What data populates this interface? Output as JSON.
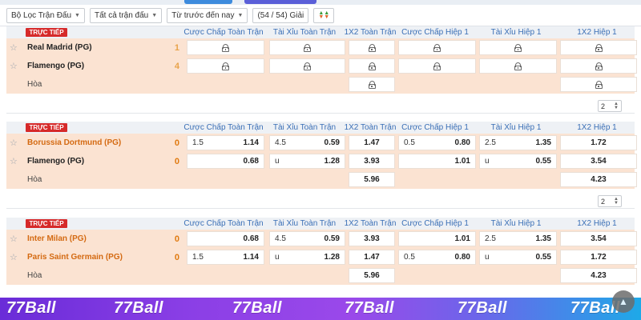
{
  "toolbar": {
    "filter_league": "Bộ Lọc Trận Đấu",
    "filter_matches": "Tất cả trận đấu",
    "sort_time": "Từ trước đến nay",
    "league_count": "(54 / 54) Giải"
  },
  "columns": [
    "Cược Chấp Toàn Trận",
    "Tài Xỉu Toàn Trận",
    "1X2 Toàn Trận",
    "Cược Chấp Hiệp 1",
    "Tài Xỉu Hiệp 1",
    "1X2 Hiệp 1"
  ],
  "live_label": "TRỰC TIẾP",
  "draw_label": "Hòa",
  "matches": [
    {
      "home": "Real Madrid (PG)",
      "home_score": "1",
      "away": "Flamengo (PG)",
      "away_score": "4",
      "locked": true,
      "pager": "2"
    },
    {
      "home": "Borussia Dortmund (PG)",
      "home_score": "0",
      "away": "Flamengo (PG)",
      "away_score": "0",
      "odds": {
        "home": {
          "hdp_line": "1.5",
          "hdp": "1.14",
          "ou_line": "4.5",
          "ou": "0.59",
          "x12": "1.47",
          "h1_hdp_line": "0.5",
          "h1_hdp": "0.80",
          "h1_ou_line": "2.5",
          "h1_ou": "1.35",
          "h1_x12": "1.72"
        },
        "away": {
          "hdp_line": "",
          "hdp": "0.68",
          "ou_line": "u",
          "ou": "1.28",
          "x12": "3.93",
          "h1_hdp_line": "",
          "h1_hdp": "1.01",
          "h1_ou_line": "u",
          "h1_ou": "0.55",
          "h1_x12": "3.54"
        },
        "draw": {
          "x12": "5.96",
          "h1_x12": "4.23"
        }
      },
      "pager": "2"
    },
    {
      "home": "Inter Milan (PG)",
      "home_score": "0",
      "away": "Paris Saint Germain (PG)",
      "away_score": "0",
      "odds": {
        "home": {
          "hdp_line": "",
          "hdp": "0.68",
          "ou_line": "4.5",
          "ou": "0.59",
          "x12": "3.93",
          "h1_hdp_line": "",
          "h1_hdp": "1.01",
          "h1_ou_line": "2.5",
          "h1_ou": "1.35",
          "h1_x12": "3.54"
        },
        "away": {
          "hdp_line": "1.5",
          "hdp": "1.14",
          "ou_line": "u",
          "ou": "1.28",
          "x12": "1.47",
          "h1_hdp_line": "0.5",
          "h1_hdp": "0.80",
          "h1_ou_line": "u",
          "h1_ou": "0.55",
          "h1_x12": "1.72"
        },
        "draw": {
          "x12": "5.96",
          "h1_x12": "4.23"
        }
      }
    }
  ],
  "brand": "77Ball",
  "colors": {
    "live": "#d62a2a",
    "header_text": "#3a6fb6",
    "team_orange": "#e0801e",
    "team_peach_bg": "#fbe3d2",
    "banner_start": "#6a2cd8",
    "banner_end": "#1ea9e8"
  }
}
